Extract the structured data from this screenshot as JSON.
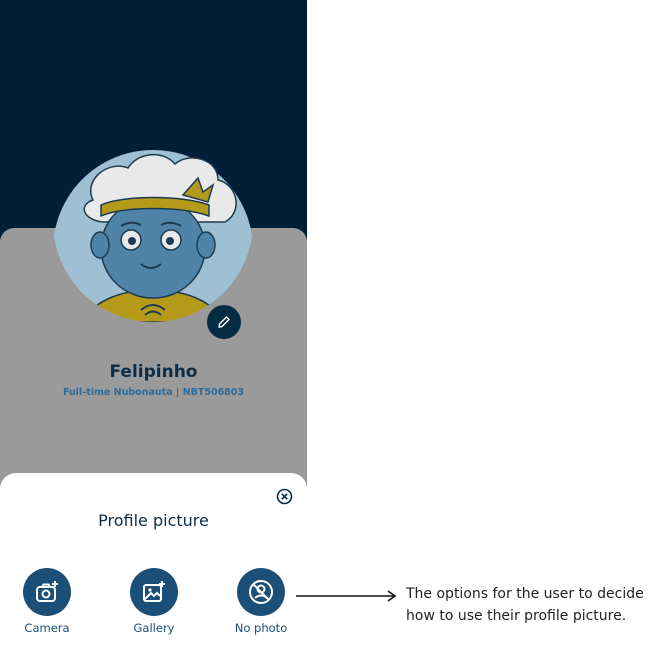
{
  "profile": {
    "name": "Felipinho",
    "role": "Full-time Nubonauta | NBT506803"
  },
  "sheet": {
    "title": "Profile picture",
    "options": [
      {
        "label": "Camera",
        "icon": "camera-add-icon"
      },
      {
        "label": "Gallery",
        "icon": "image-add-icon"
      },
      {
        "label": "No photo",
        "icon": "no-photo-icon"
      }
    ]
  },
  "annotation": {
    "text": "The options for the user to decide how to use their profile picture."
  },
  "colors": {
    "header_bg": "#001f36",
    "overlay_gray": "#9a9a9a",
    "accent": "#1c4f78",
    "title": "#0a2e4a"
  }
}
